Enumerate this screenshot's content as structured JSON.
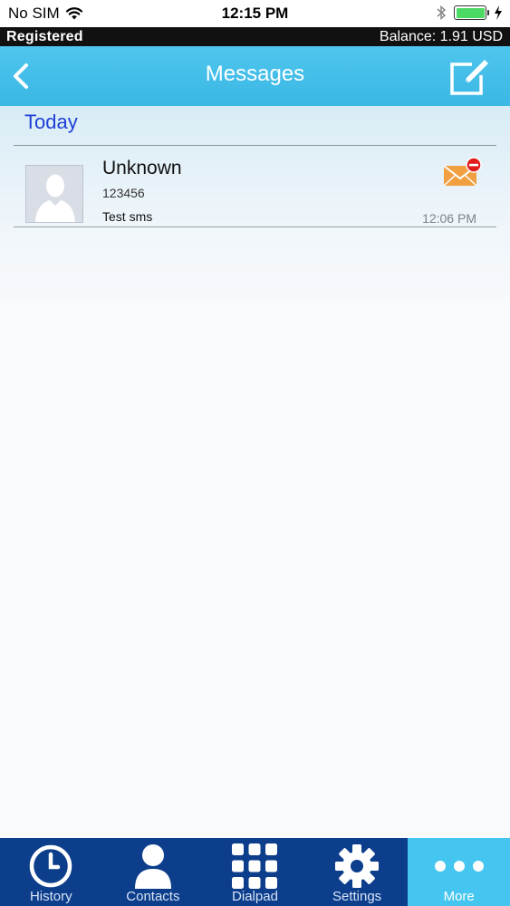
{
  "status_bar": {
    "carrier": "No SIM",
    "time": "12:15 PM"
  },
  "account_bar": {
    "status": "Registered",
    "balance": "Balance: 1.91 USD"
  },
  "header": {
    "title": "Messages"
  },
  "section": {
    "title": "Today"
  },
  "messages": [
    {
      "name": "Unknown",
      "number": "123456",
      "preview": "Test sms",
      "time": "12:06 PM"
    }
  ],
  "tabs": [
    {
      "label": "History",
      "icon": "clock-icon"
    },
    {
      "label": "Contacts",
      "icon": "person-icon"
    },
    {
      "label": "Dialpad",
      "icon": "dialpad-icon"
    },
    {
      "label": "Settings",
      "icon": "gear-icon"
    },
    {
      "label": "More",
      "icon": "more-dots-icon",
      "active": true
    }
  ],
  "colors": {
    "header": "#3ab7e4",
    "tabbar": "#0d3e8c",
    "active_tab": "#44c6f0",
    "section_title": "#1e3fd7",
    "envelope": "#f0a040",
    "badge": "#e01b1b",
    "battery": "#4cd964"
  }
}
